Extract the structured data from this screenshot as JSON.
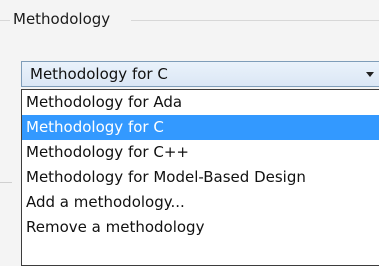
{
  "group": {
    "title": "Methodology"
  },
  "combo": {
    "selected_value": "Methodology for C",
    "dropdown_arrow_icon": "chevron-down-icon"
  },
  "dropdown": {
    "options": [
      {
        "label": "Methodology for Ada",
        "selected": false
      },
      {
        "label": "Methodology for C",
        "selected": true
      },
      {
        "label": "Methodology for C++",
        "selected": false
      },
      {
        "label": "Methodology for Model-Based Design",
        "selected": false
      },
      {
        "label": "Add a methodology...",
        "selected": false
      },
      {
        "label": "Remove a methodology",
        "selected": false
      }
    ]
  },
  "colors": {
    "selected_background": "#3399ff",
    "selected_text": "#ffffff",
    "combo_border": "#7f9db9",
    "dropdown_border": "#3d3d3d"
  }
}
